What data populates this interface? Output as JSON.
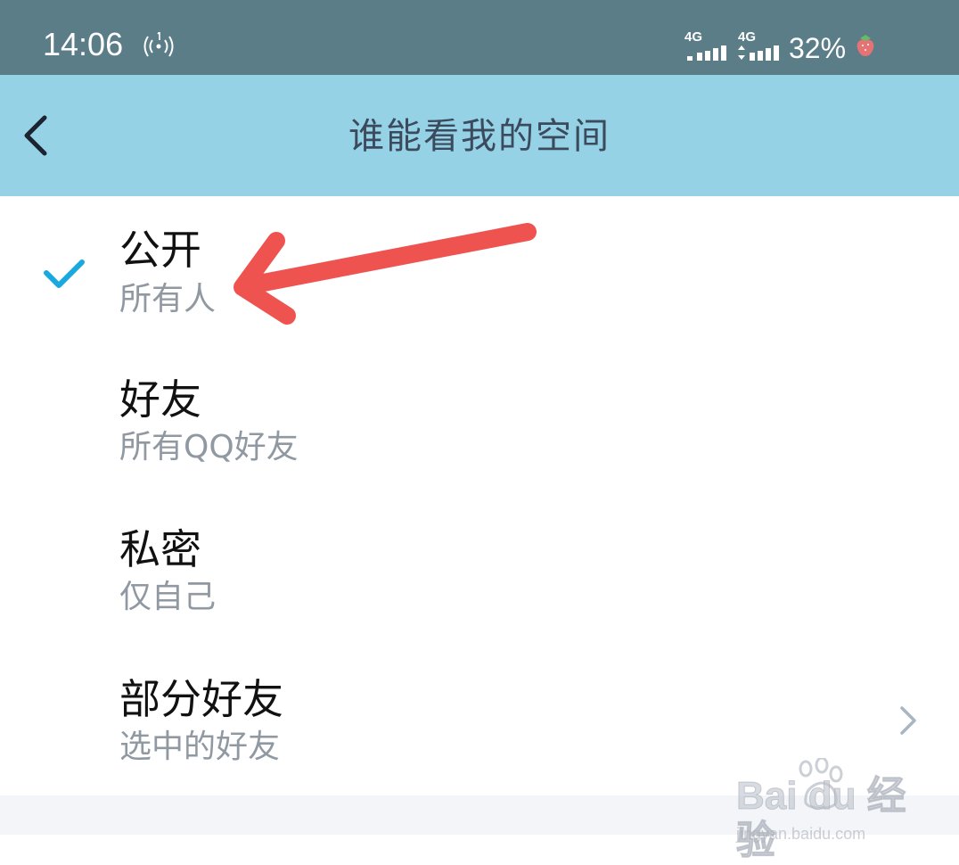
{
  "status_bar": {
    "time": "14:06",
    "sim1_label": "4G",
    "sim2_label": "4G",
    "battery": "32%"
  },
  "nav": {
    "title": "谁能看我的空间"
  },
  "options": [
    {
      "title": "公开",
      "subtitle": "所有人",
      "selected": true
    },
    {
      "title": "好友",
      "subtitle": "所有QQ好友",
      "selected": false
    },
    {
      "title": "私密",
      "subtitle": "仅自己",
      "selected": false
    },
    {
      "title": "部分好友",
      "subtitle": "选中的好友",
      "selected": false,
      "has_chevron": true
    }
  ],
  "watermark": {
    "logo": "Bai du 经验",
    "url": "jingyan.baidu.com"
  },
  "colors": {
    "status_bar_bg": "#5a7d88",
    "nav_bg": "#95d2e5",
    "check": "#1aa8e0",
    "annotation_arrow": "#ef5350"
  }
}
